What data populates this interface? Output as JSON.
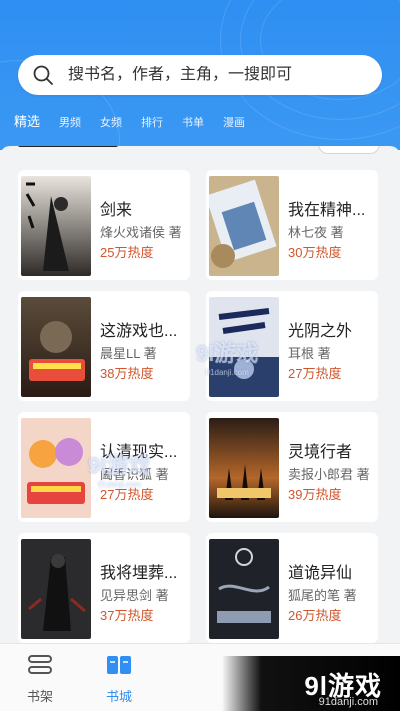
{
  "search": {
    "placeholder": "搜书名，作者，主角，一搜即可"
  },
  "tabs": [
    {
      "label": "精选",
      "active": true
    },
    {
      "label": "男频"
    },
    {
      "label": "女频"
    },
    {
      "label": "排行"
    },
    {
      "label": "书单"
    },
    {
      "label": "漫画"
    }
  ],
  "books": [
    {
      "title": "剑来",
      "author": "烽火戏诸侯 著",
      "heat": "25万热度"
    },
    {
      "title": "我在精神...",
      "author": "林七夜 著",
      "heat": "30万热度"
    },
    {
      "title": "这游戏也...",
      "author": "晨星LL 著",
      "heat": "38万热度"
    },
    {
      "title": "光阴之外",
      "author": "耳根 著",
      "heat": "27万热度"
    },
    {
      "title": "认清现实...",
      "author": "阖香识狐 著",
      "heat": "27万热度"
    },
    {
      "title": "灵境行者",
      "author": "卖报小郎君 著",
      "heat": "39万热度"
    },
    {
      "title": "我将埋葬...",
      "author": "见异思剑 著",
      "heat": "37万热度"
    },
    {
      "title": "道诡异仙",
      "author": "狐尾的笔 著",
      "heat": "26万热度"
    }
  ],
  "nav": [
    {
      "label": "书架",
      "active": false
    },
    {
      "label": "书城",
      "active": true
    }
  ],
  "watermark": {
    "logo": "9l游戏",
    "site": "91danji.com"
  },
  "colors": {
    "header": "#3292f2",
    "heat": "#d0562e",
    "nav_active": "#2f8ff2"
  }
}
